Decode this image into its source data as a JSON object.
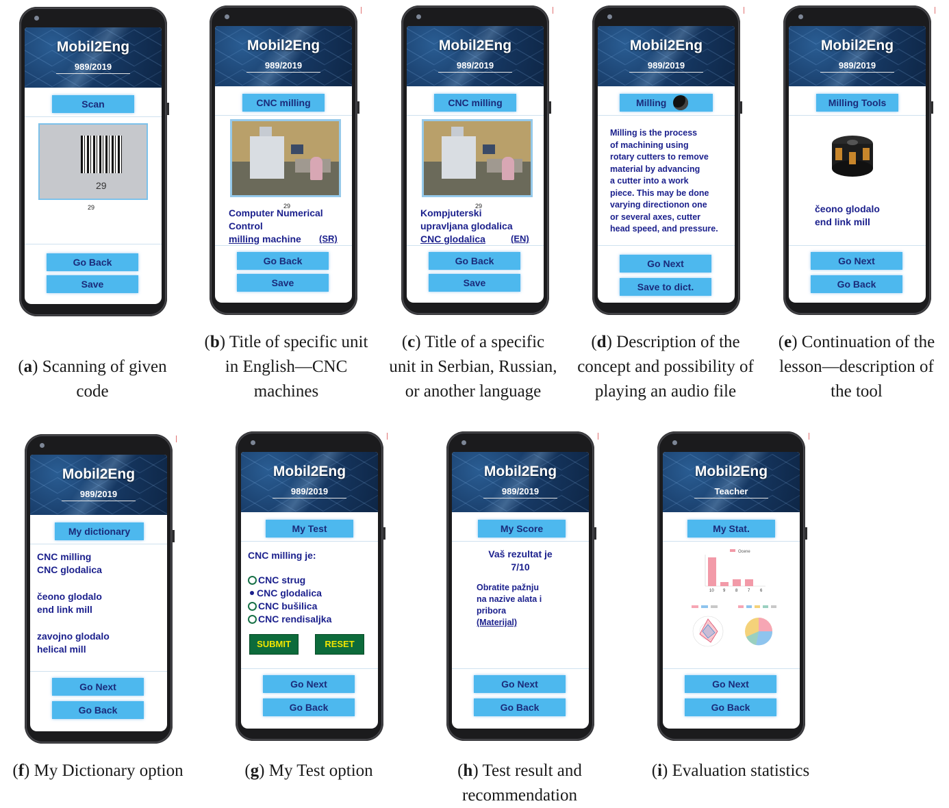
{
  "app": {
    "title": "Mobil2Eng",
    "subtitle": "989/2019",
    "teacher_subtitle": "Teacher"
  },
  "panels": {
    "a": {
      "tag": "Scan",
      "barcode_number": "29",
      "scan_result": "29",
      "buttons": [
        "Go Back",
        "Save"
      ],
      "caption_letter": "a",
      "caption_text": ") Scanning of given code"
    },
    "b": {
      "tag": "CNC milling",
      "image_number": "29",
      "line1": "Computer Numerical",
      "line2": "Control",
      "line3_underlined": "milling",
      "line3_rest": " machine",
      "lang_link": "(SR)",
      "buttons": [
        "Go Back",
        "Save"
      ],
      "caption_letter": "b",
      "caption_text": ") Title of specific unit in English—CNC machines"
    },
    "c": {
      "tag": "CNC milling",
      "image_number": "29",
      "line1": "Kompjuterski",
      "line2": "upravljana glodalica",
      "line3_underlined": "CNC glodalica",
      "lang_link": "(EN)",
      "buttons": [
        "Go Back",
        "Save"
      ],
      "caption_letter": "c",
      "caption_text": ") Title of a specific unit in Serbian, Russian, or another language"
    },
    "d": {
      "tag": "Milling",
      "description": [
        "Milling is the process",
        "of machining using",
        "rotary cutters to remove",
        "material by advancing",
        "a cutter into a work",
        "piece. This may be done",
        "varying directionon one",
        "or several axes, cutter",
        "head speed, and pressure."
      ],
      "buttons": [
        "Go Next",
        "Save to dict."
      ],
      "caption_letter": "d",
      "caption_text": ") Description of the concept and possibility of playing an audio file"
    },
    "e": {
      "tag": "Milling Tools",
      "line1": "čeono glodalo",
      "line2": "end link mill",
      "buttons": [
        "Go Next",
        "Go Back"
      ],
      "caption_letter": "e",
      "caption_text": ") Continuation of the lesson—description of the tool"
    },
    "f": {
      "tag": "My dictionary",
      "entries": [
        "CNC milling",
        "CNC glodalica",
        "čeono glodalo",
        "end link mill",
        "zavojno glodalo",
        "helical mill"
      ],
      "buttons": [
        "Go Next",
        "Go Back"
      ],
      "caption_letter": "f",
      "caption_text": ") My Dictionary option"
    },
    "g": {
      "tag": "My Test",
      "question": "CNC milling je:",
      "options": [
        "CNC strug",
        "CNC glodalica",
        "CNC bušilica",
        "CNC rendisaljka"
      ],
      "selected": "CNC glodalica",
      "submit": "SUBMIT",
      "reset": "RESET",
      "buttons": [
        "Go Next",
        "Go Back"
      ],
      "caption_letter": "g",
      "caption_text": ") My Test option"
    },
    "h": {
      "tag": "My Score",
      "result_line1": "Vaš rezultat je",
      "result_line2": "7/10",
      "note": [
        "Obratite pažnju",
        "na nazive alata i",
        "pribora"
      ],
      "link": "(Materijal)",
      "buttons": [
        "Go Next",
        "Go Back"
      ],
      "caption_letter": "h",
      "caption_text": ") Test result and recommendation"
    },
    "i": {
      "tag": "My Stat.",
      "legend": "Ocene",
      "bar_categories": [
        "10",
        "9",
        "8",
        "7",
        "6"
      ],
      "buttons": [
        "Go Next",
        "Go Back"
      ],
      "caption_letter": "i",
      "caption_text": ") Evaluation statistics"
    }
  },
  "colors": {
    "button": "#4db8ee",
    "button_text": "#1a2b7a",
    "header_bg": "#173a66",
    "dark_text": "#1a1f8c",
    "green_button": "#0d6b3b",
    "green_text": "#f2e600"
  }
}
